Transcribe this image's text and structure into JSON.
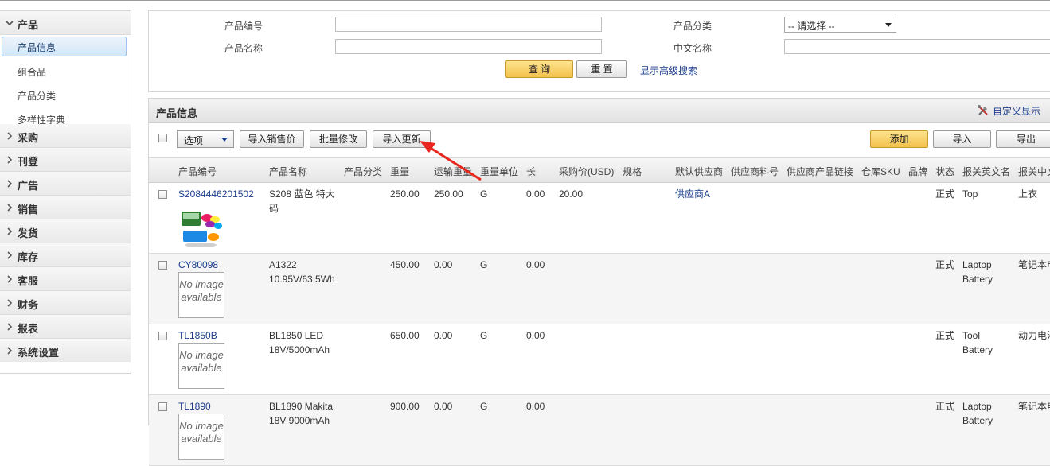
{
  "sidebar": {
    "groups": [
      {
        "label": "产品",
        "expanded": true,
        "items": [
          {
            "label": "产品信息",
            "active": true
          },
          {
            "label": "组合品"
          },
          {
            "label": "产品分类"
          },
          {
            "label": "多样性字典"
          }
        ]
      },
      {
        "label": "采购"
      },
      {
        "label": "刊登"
      },
      {
        "label": "广告"
      },
      {
        "label": "销售"
      },
      {
        "label": "发货"
      },
      {
        "label": "库存"
      },
      {
        "label": "客服"
      },
      {
        "label": "财务"
      },
      {
        "label": "报表"
      },
      {
        "label": "系统设置"
      }
    ]
  },
  "search": {
    "product_code_label": "产品编号",
    "product_code_value": "",
    "product_name_label": "产品名称",
    "product_name_value": "",
    "category_label": "产品分类",
    "category_selected": "-- 请选择 --",
    "cn_name_label": "中文名称",
    "cn_name_value": "",
    "query_button": "查 询",
    "reset_button": "重 置",
    "advanced_link": "显示高级搜索"
  },
  "panel": {
    "title": "产品信息",
    "customize_link": "自定义显示"
  },
  "toolbar": {
    "options_select": "选项",
    "import_price_button": "导入销售价",
    "batch_edit_button": "批量修改",
    "import_update_button": "导入更新",
    "add_button": "添加",
    "import_button": "导入",
    "export_button": "导出"
  },
  "table": {
    "headers": [
      "产品编号",
      "产品名称",
      "产品分类",
      "重量",
      "运输重量",
      "重量单位",
      "长",
      "采购价(USD)",
      "规格",
      "默认供应商",
      "供应商料号",
      "供应商产品链接",
      "仓库SKU",
      "品牌",
      "状态",
      "报关英文名",
      "报关中文名"
    ],
    "rows": [
      {
        "sku": "S2084446201502",
        "name": "S208 蓝色 特大码",
        "category": "",
        "weight": "250.00",
        "ship_weight": "250.00",
        "unit": "G",
        "length": "0.00",
        "price": "20.00",
        "supplier": "供应商A",
        "status": "正式",
        "en_name": "Top",
        "cn_name": "上衣",
        "image": "photo"
      },
      {
        "sku": "CY80098",
        "name": "A1322 10.95V/63.5Wh",
        "category": "",
        "weight": "450.00",
        "ship_weight": "0.00",
        "unit": "G",
        "length": "0.00",
        "price": "",
        "supplier": "",
        "status": "正式",
        "en_name": "Laptop Battery",
        "cn_name": "笔记本电池",
        "image": "none"
      },
      {
        "sku": "TL1850B",
        "name": "BL1850 LED 18V/5000mAh",
        "category": "",
        "weight": "650.00",
        "ship_weight": "0.00",
        "unit": "G",
        "length": "0.00",
        "price": "",
        "supplier": "",
        "status": "正式",
        "en_name": "Tool Battery",
        "cn_name": "动力电池",
        "image": "none"
      },
      {
        "sku": "TL1890",
        "name": "BL1890 Makita 18V 9000mAh",
        "category": "",
        "weight": "900.00",
        "ship_weight": "0.00",
        "unit": "G",
        "length": "0.00",
        "price": "",
        "supplier": "",
        "status": "正式",
        "en_name": "Laptop Battery",
        "cn_name": "笔记本电池",
        "image": "none"
      }
    ],
    "no_image_text": "No image available"
  },
  "colors": {
    "link": "#1a3c8c",
    "primary_button": "#f2c14c",
    "annotation_arrow": "#e8261e"
  }
}
